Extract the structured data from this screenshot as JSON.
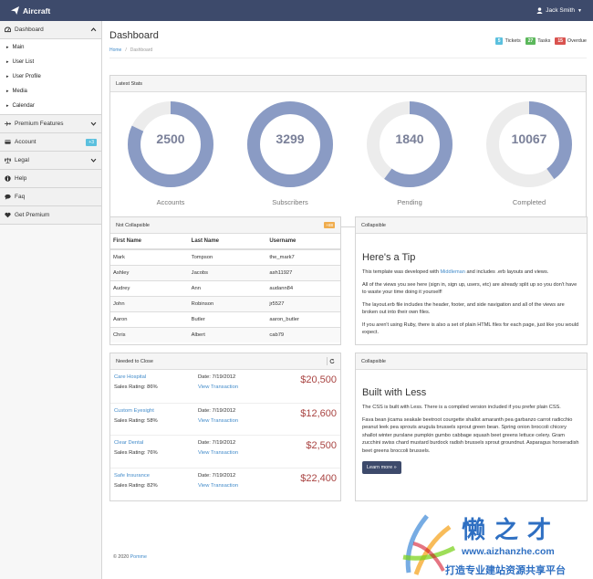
{
  "topbar": {
    "brand": "Aircraft",
    "user": "Jack Smith"
  },
  "sidebar": {
    "dashboard": "Dashboard",
    "sub": [
      "Main",
      "User List",
      "User Profile",
      "Media",
      "Calendar"
    ],
    "premium": "Premium Features",
    "account": "Account",
    "account_badge": "+3",
    "legal": "Legal",
    "help": "Help",
    "faq": "Faq",
    "get_premium": "Get Premium"
  },
  "header": {
    "title": "Dashboard",
    "crumb_home": "Home",
    "crumb_sep": "/",
    "crumb_current": "Dashboard",
    "tickets_count": "5",
    "tickets_label": "Tickets",
    "tasks_count": "27",
    "tasks_label": "Tasks",
    "overdue_count": "15",
    "overdue_label": "Overdue"
  },
  "stats": {
    "heading": "Latest Stats",
    "items": [
      {
        "value": "2500",
        "label": "Accounts",
        "fill": 0.82
      },
      {
        "value": "3299",
        "label": "Subscribers",
        "fill": 1.0
      },
      {
        "value": "1840",
        "label": "Pending",
        "fill": 0.6
      },
      {
        "value": "10067",
        "label": "Completed",
        "fill": 0.4
      }
    ]
  },
  "users_table": {
    "heading": "Not Collapsible",
    "badge": "+88",
    "headers": [
      "First Name",
      "Last Name",
      "Username"
    ],
    "rows": [
      [
        "Mark",
        "Tompson",
        "the_mark7"
      ],
      [
        "Ashley",
        "Jacobs",
        "ash11927"
      ],
      [
        "Audrey",
        "Ann",
        "audann84"
      ],
      [
        "John",
        "Robinson",
        "jr5527"
      ],
      [
        "Aaron",
        "Butler",
        "aaron_butler"
      ],
      [
        "Chris",
        "Albert",
        "cab79"
      ]
    ]
  },
  "tip": {
    "heading": "Collapsible",
    "title": "Here's a Tip",
    "p1_pre": "This template was developed with ",
    "p1_link": "Middleman",
    "p1_post": " and includes .erb layouts and views.",
    "p2": "All of the views you see here (sign in, sign up, users, etc) are already split up so you don't have to waste your time doing it yourself!",
    "p3": "The layout.erb file includes the header, footer, and side navigation and all of the views are broken out into their own files.",
    "p4": "If you aren't using Ruby, there is also a set of plain HTML files for each page, just like you would expect."
  },
  "deals": {
    "heading": "Needed to Close",
    "items": [
      {
        "name": "Care Hospital",
        "rating": "Sales Rating: 86%",
        "date": "Date: 7/19/2012",
        "link": "View Transaction",
        "amount": "$20,500"
      },
      {
        "name": "Custom Eyesight",
        "rating": "Sales Rating: 58%",
        "date": "Date: 7/19/2012",
        "link": "View Transaction",
        "amount": "$12,600"
      },
      {
        "name": "Clear Dental",
        "rating": "Sales Rating: 76%",
        "date": "Date: 7/19/2012",
        "link": "View Transaction",
        "amount": "$2,500"
      },
      {
        "name": "Safe Insurance",
        "rating": "Sales Rating: 82%",
        "date": "Date: 7/19/2012",
        "link": "View Transaction",
        "amount": "$22,400"
      }
    ]
  },
  "less": {
    "heading": "Collapsible",
    "title": "Built with Less",
    "p1": "The CSS is built with Less. There is a compiled version included if you prefer plain CSS.",
    "p2": "Fava bean jicama seakale beetroot courgette shallot amaranth pea garbanzo carrot radicchio peanut leek pea sprouts arugula brussels sprout green bean. Spring onion broccoli chicory shallot winter purslane pumpkin gumbo cabbage squash beet greens lettuce celery. Gram zucchini swiss chard mustard burdock radish brussels sprout groundnut. Asparagus horseradish beet greens broccoli brussels.",
    "button": "Learn more »"
  },
  "footer": {
    "text": "© 2020 ",
    "link": "Pomme"
  },
  "watermark": {
    "brand": "懒之才",
    "url": "www.aizhanzhe.com",
    "slogan": "打造专业建站资源共享平台"
  },
  "colors": {
    "topbar": "#3d4a6b",
    "donut": "#8a9bc4",
    "donut_track": "#ececec",
    "tickets": "#5bc0de",
    "tasks": "#5cb85c",
    "overdue": "#d9534f",
    "amount": "#a94442"
  }
}
